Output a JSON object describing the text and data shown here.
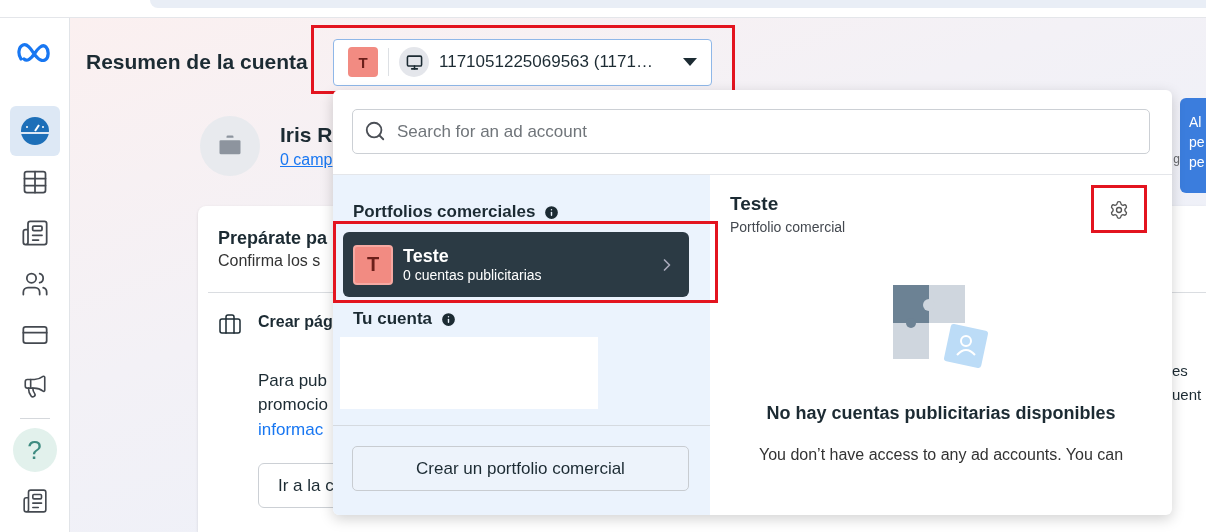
{
  "sidebar": {
    "help_label": "?",
    "items": [
      {
        "selected": true
      },
      {
        "selected": false
      },
      {
        "selected": false
      },
      {
        "selected": false
      },
      {
        "selected": false
      },
      {
        "selected": false
      },
      {
        "selected": false
      },
      {
        "selected": false
      }
    ]
  },
  "header": {
    "title": "Resumen de la cuenta"
  },
  "account_selector": {
    "avatar_letter": "T",
    "account": "1171051225069563 (1171…",
    "highlighted": true
  },
  "profile": {
    "name": "Iris R",
    "link": "0 camp",
    "side_text": "g"
  },
  "tooltip": {
    "lines": [
      "Al",
      "pe",
      "pe"
    ]
  },
  "card": {
    "title": "Prepárate pa",
    "subtitle": "Confirma los s",
    "task": {
      "title": "Crear pág",
      "lines": [
        "Para pub",
        "promocio"
      ],
      "link": "informac",
      "button": "Ir a la c"
    },
    "right_lines": [
      "es",
      "uent"
    ]
  },
  "dropdown": {
    "search": {
      "placeholder": "Search for an ad account"
    },
    "portfolios_heading": "Portfolios comerciales",
    "portfolios": [
      {
        "letter": "T",
        "name": "Teste",
        "count": "0 cuentas publicitarias",
        "selected": true,
        "highlighted": true
      }
    ],
    "your_account_heading": "Tu cuenta",
    "create_button": "Crear un portfolio comercial",
    "detail": {
      "name": "Teste",
      "subtitle": "Portfolio comercial",
      "settings_highlighted": true,
      "empty_title": "No hay cuentas publicitarias disponibles",
      "empty_text": "You don’t have access to any ad accounts. You can"
    }
  }
}
